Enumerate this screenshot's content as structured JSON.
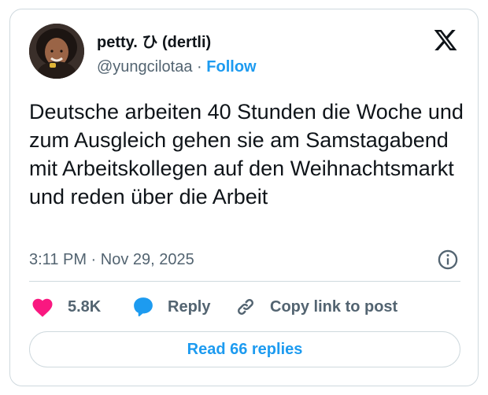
{
  "author": {
    "display_name": "petty. ひ (dertli)",
    "handle": "@yungcilotaa",
    "separator": "·",
    "follow_label": "Follow",
    "avatar_icon": "user-avatar"
  },
  "brand": {
    "logo_icon": "x-logo"
  },
  "tweet": {
    "text": "Deutsche arbeiten 40 Stunden die Woche und zum Ausgleich gehen sie am Samstagabend mit Arbeitskollegen auf den Weihnachtsmarkt und reden über die Arbeit",
    "timestamp": "3:11 PM · Nov 29, 2025"
  },
  "actions": {
    "like_count": "5.8K",
    "like_icon": "heart-icon",
    "reply_label": "Reply",
    "reply_icon": "speech-bubble-icon",
    "copy_label": "Copy link to post",
    "copy_icon": "link-icon",
    "info_icon": "info-icon"
  },
  "footer": {
    "read_replies_label": "Read 66 replies"
  },
  "colors": {
    "accent": "#1d9bf0",
    "heart": "#f91880",
    "text_primary": "#0f1419",
    "text_secondary": "#536471",
    "border": "#cfd9de"
  }
}
